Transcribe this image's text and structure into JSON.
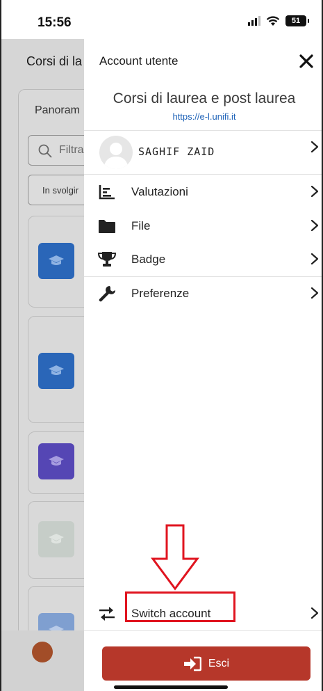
{
  "status_bar": {
    "time": "15:56",
    "battery": "51"
  },
  "background": {
    "title": "Corsi di la",
    "tab": "Panoram",
    "filter_placeholder": "Filtra",
    "select_value": "In svolgir"
  },
  "drawer": {
    "title": "Account utente",
    "site_name": "Corsi di laurea e post laurea",
    "site_url": "https://e-l.unifi.it",
    "user_name": "SAGHIF ZAID",
    "menu": [
      {
        "label": "Valutazioni",
        "icon": "grades-icon"
      },
      {
        "label": "File",
        "icon": "folder-icon"
      },
      {
        "label": "Badge",
        "icon": "trophy-icon"
      },
      {
        "label": "Preferenze",
        "icon": "wrench-icon"
      }
    ],
    "switch_account_label": "Switch account",
    "logout_label": "Esci"
  },
  "colors": {
    "logout": "#b6372a",
    "highlight": "#e0141f",
    "link": "#1f63b8",
    "course_blue": "#2a66b8",
    "course_purple": "#5546b4"
  }
}
